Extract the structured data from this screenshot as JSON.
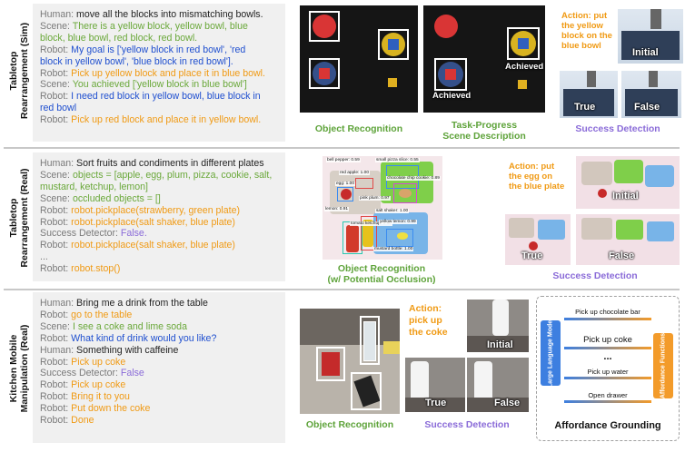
{
  "rows": [
    {
      "label": "Tabletop\nRearrangement (Sim)",
      "lines": [
        {
          "speaker": "Human:",
          "text": "move all the blocks into mismatching bowls.",
          "color": "c-black"
        },
        {
          "speaker": "Scene:",
          "text": "There is a yellow block, yellow bowl, blue",
          "color": "c-green"
        },
        {
          "speaker": "",
          "text": "block, blue bowl, red block, red bowl.",
          "color": "c-green"
        },
        {
          "speaker": "Robot:",
          "text": "My goal is ['yellow block in red bowl', 'red",
          "color": "c-blue"
        },
        {
          "speaker": "",
          "text": "block in yellow bowl', 'blue block in red bowl'].",
          "color": "c-blue"
        },
        {
          "speaker": "Robot:",
          "text": "Pick up yellow block and place it in blue bowl.",
          "color": "c-orange"
        },
        {
          "speaker": "Scene:",
          "text": "You achieved ['yellow block in blue bowl']",
          "color": "c-green"
        },
        {
          "speaker": "Robot:",
          "text": "I need red block in yellow bowl, blue block in",
          "color": "c-blue"
        },
        {
          "speaker": "",
          "text": "red bowl",
          "color": "c-blue"
        },
        {
          "speaker": "Robot:",
          "text": "Pick up red block and place it in yellow bowl.",
          "color": "c-orange"
        }
      ],
      "captions": [
        "Object Recognition",
        "Task-Progress\nScene Description",
        "Success Detection"
      ],
      "action": "Action: put\nthe yellow\nblock on the\nblue bowl",
      "tags": {
        "achieved1": "Achieved",
        "achieved2": "Achieved",
        "initial": "Initial",
        "true": "True",
        "false": "False"
      }
    },
    {
      "label": "Tabletop\nRearrangement (Real)",
      "lines": [
        {
          "speaker": "Human:",
          "text": "Sort fruits and condiments in different plates",
          "color": "c-black"
        },
        {
          "speaker": "Scene:",
          "text": "objects = [apple, egg, plum, pizza, cookie, salt,",
          "color": "c-green"
        },
        {
          "speaker": "",
          "text": "mustard, ketchup, lemon]",
          "color": "c-green"
        },
        {
          "speaker": "Scene:",
          "text": "occluded objects = []",
          "color": "c-green"
        },
        {
          "speaker": "Robot:",
          "text": "robot.pickplace(strawberry, green plate)",
          "color": "c-orange"
        },
        {
          "speaker": "Robot:",
          "text": "robot.pickplace(salt shaker, blue plate)",
          "color": "c-orange"
        },
        {
          "speaker": "Success Detector:",
          "text": "False.",
          "color": "c-purple"
        },
        {
          "speaker": "Robot:",
          "text": "robot.pickplace(salt shaker, blue plate)",
          "color": "c-orange"
        },
        {
          "speaker": "...",
          "text": "",
          "color": "c-grey"
        },
        {
          "speaker": "Robot:",
          "text": "robot.stop()",
          "color": "c-orange"
        }
      ],
      "captions": [
        "Object Recognition\n(w/ Potential Occlusion)",
        "Success Detection"
      ],
      "action": "Action: put\nthe egg on\nthe blue plate",
      "detections": [
        "bell pepper: 0.59",
        "small pizza slice: 0.55",
        "red apple: 1.00",
        "egg: 1.00",
        "chocolate chip cookie: 0.89",
        "pink plum: 0.97",
        "lemon: 0.91",
        "salt shaker: 1.00",
        "tomato ketchup: 0.80",
        "yellow lemon: 0.99",
        "mustard bottle: 1.00"
      ],
      "tags": {
        "initial": "Initial",
        "true": "True",
        "false": "False"
      }
    },
    {
      "label": "Kitchen Mobile\nManipulation (Real)",
      "lines": [
        {
          "speaker": "Human:",
          "text": "Bring me a drink from the table",
          "color": "c-black"
        },
        {
          "speaker": "Robot:",
          "text": "go to the table",
          "color": "c-orange"
        },
        {
          "speaker": "Scene:",
          "text": "I see a coke and lime soda",
          "color": "c-green"
        },
        {
          "speaker": "Robot:",
          "text": "What kind of drink would you like?",
          "color": "c-blue"
        },
        {
          "speaker": "Human:",
          "text": "Something with caffeine",
          "color": "c-black"
        },
        {
          "speaker": "Robot:",
          "text": "Pick up coke",
          "color": "c-orange"
        },
        {
          "speaker": "Success Detector:",
          "text": "False",
          "color": "c-purple"
        },
        {
          "speaker": "Robot:",
          "text": "Pick up coke",
          "color": "c-orange"
        },
        {
          "speaker": "Robot:",
          "text": "Bring it to you",
          "color": "c-orange"
        },
        {
          "speaker": "Robot:",
          "text": "Put down the coke",
          "color": "c-orange"
        },
        {
          "speaker": "Robot:",
          "text": "Done",
          "color": "c-orange"
        }
      ],
      "captions": [
        "Object Recognition",
        "Success Detection",
        "Affordance Grounding"
      ],
      "action": "Action:\npick up\nthe coke",
      "tags": {
        "initial": "Initial",
        "true": "True",
        "false": "False"
      },
      "affordance": {
        "llm": "Large Language Model",
        "functions": "Affordance Functions",
        "options": [
          "Pick up chocolate bar",
          "Pick up coke",
          "...",
          "Pick up water",
          "Open drawer"
        ]
      }
    }
  ]
}
